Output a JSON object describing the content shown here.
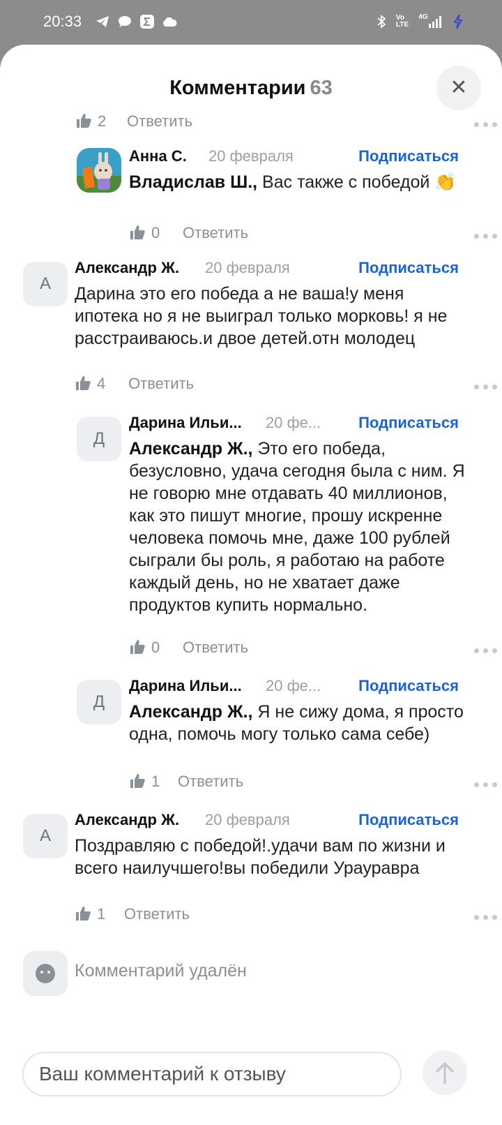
{
  "status_bar": {
    "time": "20:33",
    "right_tags": {
      "volte": "Vo LTE",
      "network": "4G"
    }
  },
  "header": {
    "title": "Комментарии",
    "count": "63"
  },
  "comments": [
    {
      "likes": "2",
      "reply": "Ответить"
    },
    {
      "author": "Анна С.",
      "date": "20 февраля",
      "subscribe": "Подписаться",
      "mention": "Владислав Ш.,",
      "text": " Вас также с победой 👏",
      "likes": "0",
      "reply": "Ответить"
    },
    {
      "avatar_letter": "А",
      "author": "Александр Ж.",
      "date": "20 февраля",
      "subscribe": "Подписаться",
      "text": "Дарина это его победа а не ваша!у меня ипотека но я не выиграл только морковь! я не расстраиваюсь.и двое детей.отн молодец",
      "likes": "4",
      "reply": "Ответить"
    },
    {
      "avatar_letter": "Д",
      "author": "Дарина Ильи...",
      "date": "20 фе...",
      "subscribe": "Подписаться",
      "mention": "Александр Ж.,",
      "text": " Это его победа, безусловно, удача сегодня была с ним. Я не говорю мне отдавать 40 миллионов, как это пишут многие, прошу искренне человека помочь мне, даже 100 рублей сыграли бы роль, я работаю на работе каждый день, но не хватает даже продуктов купить нормально.",
      "likes": "0",
      "reply": "Ответить"
    },
    {
      "avatar_letter": "Д",
      "author": "Дарина Ильи...",
      "date": "20 фе...",
      "subscribe": "Подписаться",
      "mention": "Александр Ж.,",
      "text": " Я не сижу дома, я просто одна, помочь могу только сама себе)",
      "likes": "1",
      "reply": "Ответить"
    },
    {
      "avatar_letter": "А",
      "author": "Александр Ж.",
      "date": "20 февраля",
      "subscribe": "Подписаться",
      "text": "Поздравляю с победой!.удачи вам по жизни и всего наилучшего!вы победили Урауравра",
      "likes": "1",
      "reply": "Ответить"
    },
    {
      "text": "Комментарий удалён"
    }
  ],
  "composer": {
    "placeholder": "Ваш комментарий к отзыву"
  },
  "icons": {
    "close": "close-icon",
    "like": "thumbs-up-icon",
    "more": "more-dots-icon",
    "send": "arrow-up-icon"
  },
  "colors": {
    "accent": "#1a63d8",
    "muted": "#8a9098",
    "avatar_bg": "#eceef2"
  }
}
